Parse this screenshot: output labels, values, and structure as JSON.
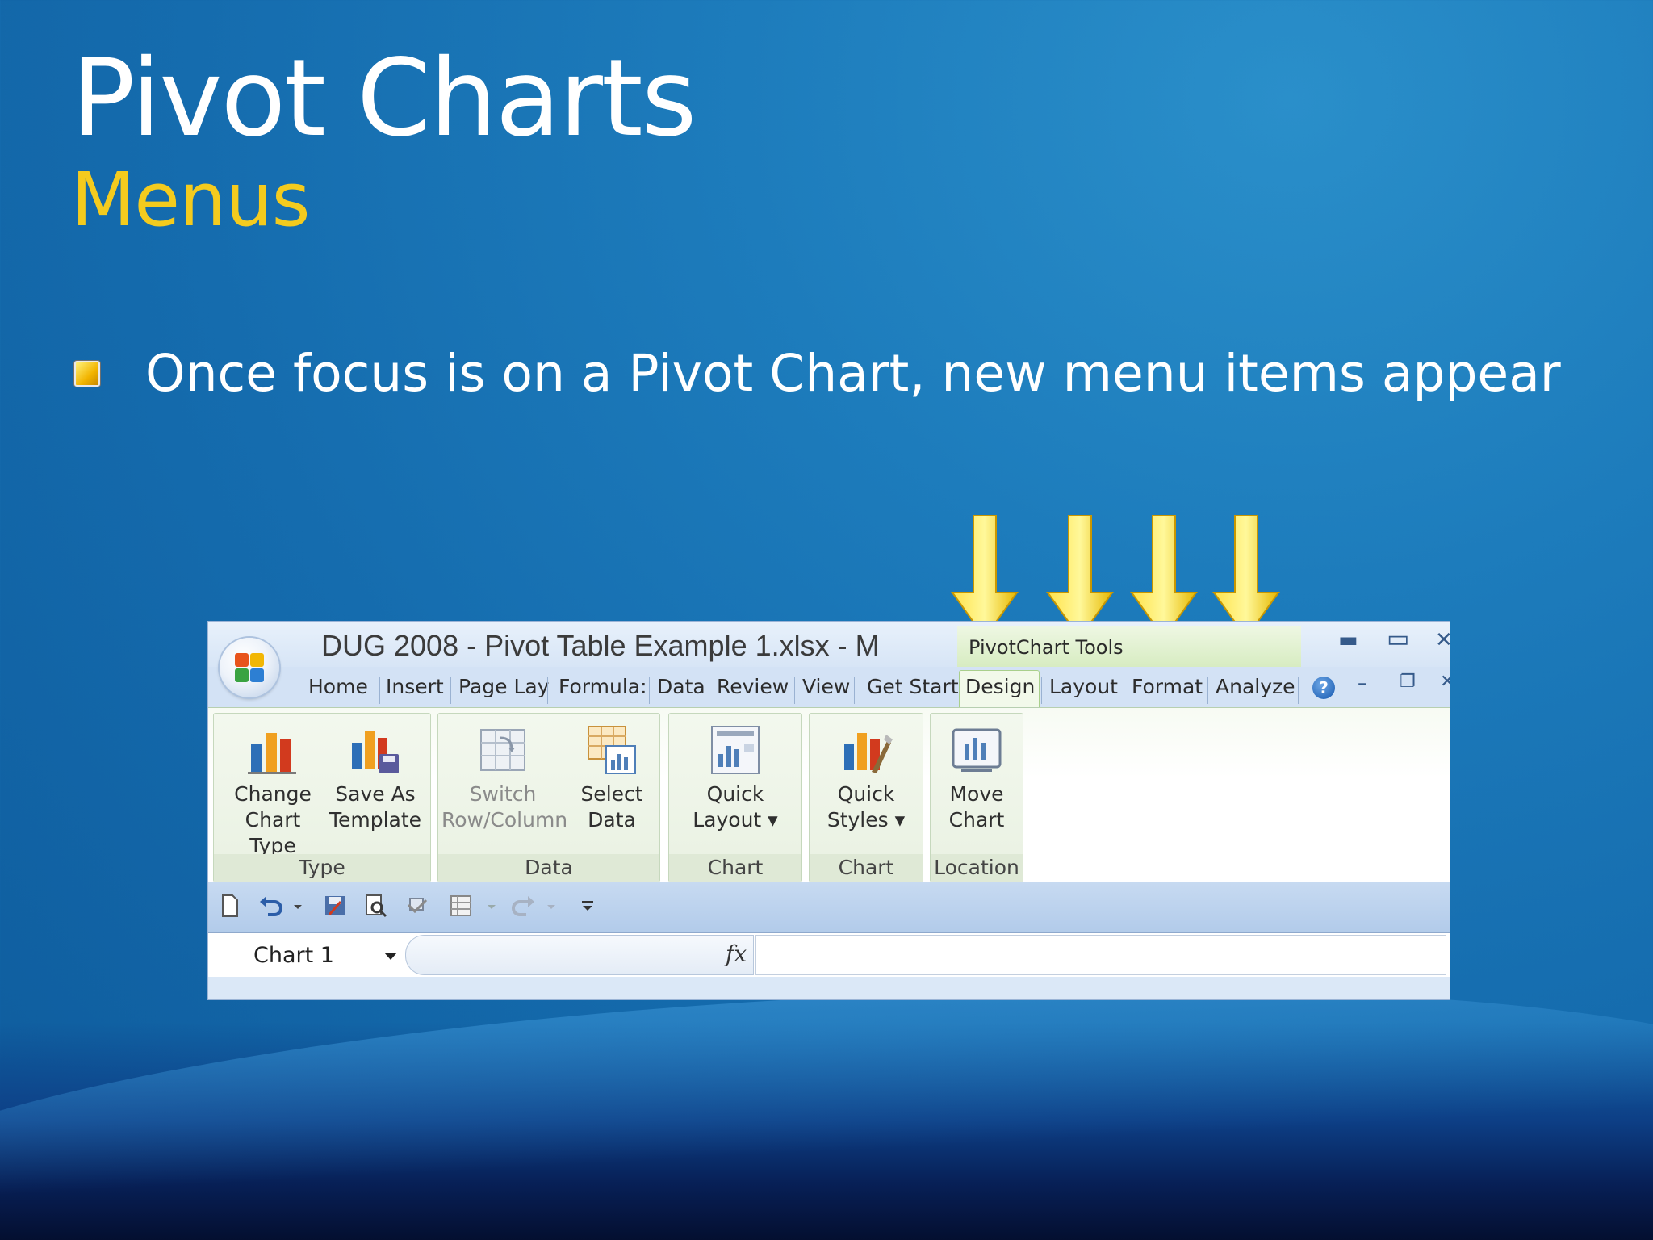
{
  "slide": {
    "title": "Pivot Charts",
    "subtitle": "Menus",
    "bullet": "Once focus is on a Pivot Chart, new menu items appear"
  },
  "colors": {
    "accent": "#f4cb1e",
    "arrow": "#f5d200",
    "context_tab": "#d7ecc1"
  },
  "excel": {
    "window_title": "DUG 2008 - Pivot Table Example 1.xlsx - M",
    "context_tools_label": "PivotChart Tools",
    "tabs": [
      {
        "label": "Home"
      },
      {
        "label": "Insert"
      },
      {
        "label": "Page Lay"
      },
      {
        "label": "Formula:"
      },
      {
        "label": "Data"
      },
      {
        "label": "Review"
      },
      {
        "label": "View"
      },
      {
        "label": "Get Start"
      },
      {
        "label": "Design",
        "active": true
      },
      {
        "label": "Layout"
      },
      {
        "label": "Format"
      },
      {
        "label": "Analyze"
      }
    ],
    "groups": {
      "type": {
        "label": "Type",
        "change_chart_type": {
          "line1": "Change",
          "line2": "Chart Type"
        },
        "save_as_template": {
          "line1": "Save As",
          "line2": "Template"
        }
      },
      "data": {
        "label": "Data",
        "switch_row_column": {
          "line1": "Switch",
          "line2": "Row/Column",
          "disabled": true
        },
        "select_data": {
          "line1": "Select",
          "line2": "Data"
        }
      },
      "chart_layouts": {
        "label": "Chart Layouts",
        "quick_layout": {
          "line1": "Quick",
          "line2": "Layout ▾"
        }
      },
      "chart_styles": {
        "label": "Chart Styles",
        "quick_styles": {
          "line1": "Quick",
          "line2": "Styles ▾"
        }
      },
      "location": {
        "label": "Location",
        "move_chart": {
          "line1": "Move",
          "line2": "Chart"
        }
      }
    },
    "name_box": "Chart 1",
    "fx_label": "fx",
    "icons": [
      "office-button-icon",
      "help-icon",
      "minimize-icon",
      "maximize-icon",
      "close-icon",
      "new-doc-icon",
      "undo-icon",
      "save-icon",
      "print-preview-icon",
      "spelling-icon",
      "table-icon",
      "redo-icon",
      "customize-qat-icon"
    ]
  }
}
